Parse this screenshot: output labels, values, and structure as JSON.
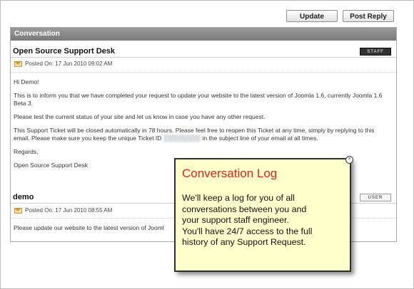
{
  "toolbar": {
    "update_label": "Update",
    "post_reply_label": "Post Reply"
  },
  "conversation": {
    "header": "Conversation",
    "messages": [
      {
        "author": "Open Source Support Desk",
        "badge": "STAFF",
        "posted_on": "Posted On: 17 Jun 2010 09:02 AM",
        "body": {
          "greeting": "Hi Demo!",
          "p1": "This is to inform you that we have completed your request to update your website to the latest version of Joomla 1.6, currently Joomla 1.6 Beta 3.",
          "p2": "Please test the current status of your site and let us know in case you have any other request.",
          "p3_start": "This Support Ticket will be closed automatically in 78 hours. Please feel free to reopen this Ticket at any time, simply by replying to this email. Please make sure you keep the unique Ticket ID",
          "ticket_id_redacted": "OSY-657626",
          "p3_end": "in the subject line of your email at all times.",
          "signoff": "Regards,",
          "signature": "Open Source Support Desk"
        }
      },
      {
        "author": "demo",
        "badge": "USER",
        "posted_on": "Posted On: 17 Jun 2010 08:55 AM",
        "body": {
          "text": "Please update our website to the latest version of Jooml"
        }
      }
    ]
  },
  "tooltip": {
    "title": "Conversation Log",
    "lines": [
      "We'll keep a log for you of all",
      "conversations between you and",
      "your support staff engineer.",
      "You'll have 24/7 access to the full",
      "history of any Support Request."
    ]
  },
  "icons": {
    "envelope": "envelope-icon",
    "close": "close-icon"
  }
}
